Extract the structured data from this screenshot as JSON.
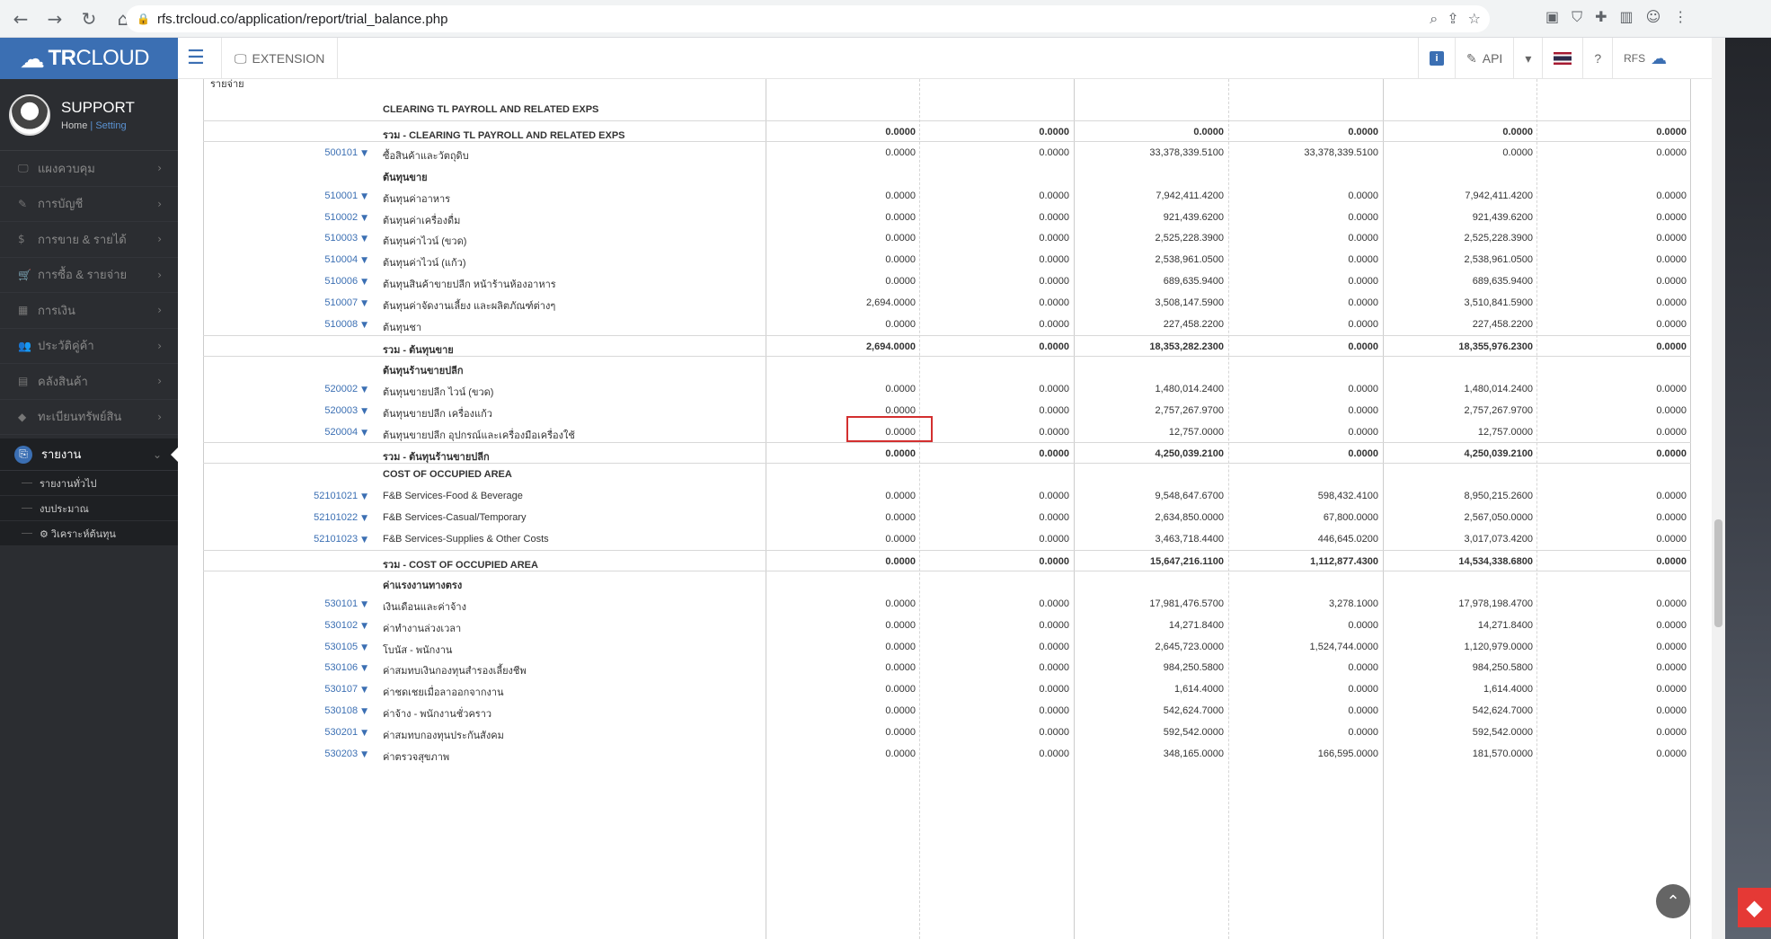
{
  "browser": {
    "url": "rfs.trcloud.co/application/report/trial_balance.php"
  },
  "app": {
    "brand_tr": "TR",
    "brand_cloud": "CLOUD",
    "extension_label": "EXTENSION",
    "api_label": "API",
    "info_badge": "i",
    "user_label": "RFS"
  },
  "profile": {
    "name": "SUPPORT",
    "home_link": "Home",
    "separator": "|",
    "setting_link": "Setting"
  },
  "menu": [
    {
      "label": "แผงควบคุม",
      "icon": "🖵"
    },
    {
      "label": "การบัญชี",
      "icon": "✎"
    },
    {
      "label": "การขาย & รายได้",
      "icon": "$"
    },
    {
      "label": "การซื้อ & รายจ่าย",
      "icon": "🛒"
    },
    {
      "label": "การเงิน",
      "icon": "▦"
    },
    {
      "label": "ประวัติคู่ค้า",
      "icon": "👥"
    },
    {
      "label": "คลังสินค้า",
      "icon": "▤"
    },
    {
      "label": "ทะเบียนทรัพย์สิน",
      "icon": "◆"
    }
  ],
  "active_menu": {
    "label": "รายงาน",
    "icon": "⎘"
  },
  "submenu": [
    "รายงานทั่วไป",
    "งบประมาณ",
    "⚙ วิเคราะห์ต้นทุน"
  ],
  "report": {
    "top_label": "รายจ่าย",
    "rows": [
      {
        "type": "header",
        "code": "",
        "name": "CLEARING TL PAYROLL AND RELATED EXPS",
        "v": [
          "",
          "",
          "",
          "",
          "",
          ""
        ]
      },
      {
        "type": "total",
        "code": "",
        "name": "รวม - CLEARING TL PAYROLL AND RELATED EXPS",
        "v": [
          "0.0000",
          "0.0000",
          "0.0000",
          "0.0000",
          "0.0000",
          "0.0000"
        ]
      },
      {
        "type": "item",
        "code": "500101",
        "name": "ซื้อสินค้าและวัตถุดิบ",
        "v": [
          "0.0000",
          "0.0000",
          "33,378,339.5100",
          "33,378,339.5100",
          "0.0000",
          "0.0000"
        ]
      },
      {
        "type": "header",
        "code": "",
        "name": "ต้นทุนขาย",
        "v": [
          "",
          "",
          "",
          "",
          "",
          ""
        ]
      },
      {
        "type": "item",
        "code": "510001",
        "name": "ต้นทุนค่าอาหาร",
        "v": [
          "0.0000",
          "0.0000",
          "7,942,411.4200",
          "0.0000",
          "7,942,411.4200",
          "0.0000"
        ]
      },
      {
        "type": "item",
        "code": "510002",
        "name": "ต้นทุนค่าเครื่องดื่ม",
        "v": [
          "0.0000",
          "0.0000",
          "921,439.6200",
          "0.0000",
          "921,439.6200",
          "0.0000"
        ]
      },
      {
        "type": "item",
        "code": "510003",
        "name": "ต้นทุนค่าไวน์ (ขวด)",
        "v": [
          "0.0000",
          "0.0000",
          "2,525,228.3900",
          "0.0000",
          "2,525,228.3900",
          "0.0000"
        ]
      },
      {
        "type": "item",
        "code": "510004",
        "name": "ต้นทุนค่าไวน์ (แก้ว)",
        "v": [
          "0.0000",
          "0.0000",
          "2,538,961.0500",
          "0.0000",
          "2,538,961.0500",
          "0.0000"
        ]
      },
      {
        "type": "item",
        "code": "510006",
        "name": "ต้นทุนสินค้าขายปลีก หน้าร้านห้องอาหาร",
        "v": [
          "0.0000",
          "0.0000",
          "689,635.9400",
          "0.0000",
          "689,635.9400",
          "0.0000"
        ]
      },
      {
        "type": "item",
        "code": "510007",
        "name": "ต้นทุนค่าจัดงานเลี้ยง และผลิตภัณฑ์ต่างๆ",
        "v": [
          "2,694.0000",
          "0.0000",
          "3,508,147.5900",
          "0.0000",
          "3,510,841.5900",
          "0.0000"
        ]
      },
      {
        "type": "item",
        "code": "510008",
        "name": "ต้นทุนชา",
        "v": [
          "0.0000",
          "0.0000",
          "227,458.2200",
          "0.0000",
          "227,458.2200",
          "0.0000"
        ]
      },
      {
        "type": "total",
        "code": "",
        "name": "รวม - ต้นทุนขาย",
        "v": [
          "2,694.0000",
          "0.0000",
          "18,353,282.2300",
          "0.0000",
          "18,355,976.2300",
          "0.0000"
        ]
      },
      {
        "type": "header",
        "code": "",
        "name": "ต้นทุนร้านขายปลีก",
        "v": [
          "",
          "",
          "",
          "",
          "",
          ""
        ]
      },
      {
        "type": "item",
        "code": "520002",
        "name": "ต้นทุนขายปลีก ไวน์ (ขวด)",
        "v": [
          "0.0000",
          "0.0000",
          "1,480,014.2400",
          "0.0000",
          "1,480,014.2400",
          "0.0000"
        ]
      },
      {
        "type": "item",
        "code": "520003",
        "name": "ต้นทุนขายปลีก เครื่องแก้ว",
        "v": [
          "0.0000",
          "0.0000",
          "2,757,267.9700",
          "0.0000",
          "2,757,267.9700",
          "0.0000"
        ]
      },
      {
        "type": "item",
        "code": "520004",
        "name": "ต้นทุนขายปลีก อุปกรณ์และเครื่องมือเครื่องใช้",
        "v": [
          "0.0000",
          "0.0000",
          "12,757.0000",
          "0.0000",
          "12,757.0000",
          "0.0000"
        ]
      },
      {
        "type": "total",
        "code": "",
        "name": "รวม - ต้นทุนร้านขายปลีก",
        "v": [
          "0.0000",
          "0.0000",
          "4,250,039.2100",
          "0.0000",
          "4,250,039.2100",
          "0.0000"
        ]
      },
      {
        "type": "header",
        "code": "",
        "name": "COST OF OCCUPIED AREA",
        "v": [
          "",
          "",
          "",
          "",
          "",
          ""
        ]
      },
      {
        "type": "item",
        "code": "52101021",
        "name": "F&B Services-Food & Beverage",
        "v": [
          "0.0000",
          "0.0000",
          "9,548,647.6700",
          "598,432.4100",
          "8,950,215.2600",
          "0.0000"
        ]
      },
      {
        "type": "item",
        "code": "52101022",
        "name": "F&B Services-Casual/Temporary",
        "v": [
          "0.0000",
          "0.0000",
          "2,634,850.0000",
          "67,800.0000",
          "2,567,050.0000",
          "0.0000"
        ]
      },
      {
        "type": "item",
        "code": "52101023",
        "name": "F&B Services-Supplies & Other Costs",
        "v": [
          "0.0000",
          "0.0000",
          "3,463,718.4400",
          "446,645.0200",
          "3,017,073.4200",
          "0.0000"
        ]
      },
      {
        "type": "total",
        "code": "",
        "name": "รวม - COST OF OCCUPIED AREA",
        "v": [
          "0.0000",
          "0.0000",
          "15,647,216.1100",
          "1,112,877.4300",
          "14,534,338.6800",
          "0.0000"
        ]
      },
      {
        "type": "header",
        "code": "",
        "name": "ค่าแรงงานทางตรง",
        "v": [
          "",
          "",
          "",
          "",
          "",
          ""
        ]
      },
      {
        "type": "item",
        "code": "530101",
        "name": "เงินเดือนและค่าจ้าง",
        "v": [
          "0.0000",
          "0.0000",
          "17,981,476.5700",
          "3,278.1000",
          "17,978,198.4700",
          "0.0000"
        ]
      },
      {
        "type": "item",
        "code": "530102",
        "name": "ค่าทำงานล่วงเวลา",
        "v": [
          "0.0000",
          "0.0000",
          "14,271.8400",
          "0.0000",
          "14,271.8400",
          "0.0000"
        ]
      },
      {
        "type": "item",
        "code": "530105",
        "name": "โบนัส - พนักงาน",
        "v": [
          "0.0000",
          "0.0000",
          "2,645,723.0000",
          "1,524,744.0000",
          "1,120,979.0000",
          "0.0000"
        ]
      },
      {
        "type": "item",
        "code": "530106",
        "name": "ค่าสมทบเงินกองทุนสำรองเลี้ยงชีพ",
        "v": [
          "0.0000",
          "0.0000",
          "984,250.5800",
          "0.0000",
          "984,250.5800",
          "0.0000"
        ]
      },
      {
        "type": "item",
        "code": "530107",
        "name": "ค่าชดเชยเมื่อลาออกจากงาน",
        "v": [
          "0.0000",
          "0.0000",
          "1,614.4000",
          "0.0000",
          "1,614.4000",
          "0.0000"
        ]
      },
      {
        "type": "item",
        "code": "530108",
        "name": "ค่าจ้าง - พนักงานชั่วคราว",
        "v": [
          "0.0000",
          "0.0000",
          "542,624.7000",
          "0.0000",
          "542,624.7000",
          "0.0000"
        ]
      },
      {
        "type": "item",
        "code": "530201",
        "name": "ค่าสมทบกองทุนประกันสังคม",
        "v": [
          "0.0000",
          "0.0000",
          "592,542.0000",
          "0.0000",
          "592,542.0000",
          "0.0000"
        ]
      },
      {
        "type": "item",
        "code": "530203",
        "name": "ค่าตรวจสุขภาพ",
        "v": [
          "0.0000",
          "0.0000",
          "348,165.0000",
          "166,595.0000",
          "181,570.0000",
          "0.0000"
        ]
      }
    ]
  }
}
